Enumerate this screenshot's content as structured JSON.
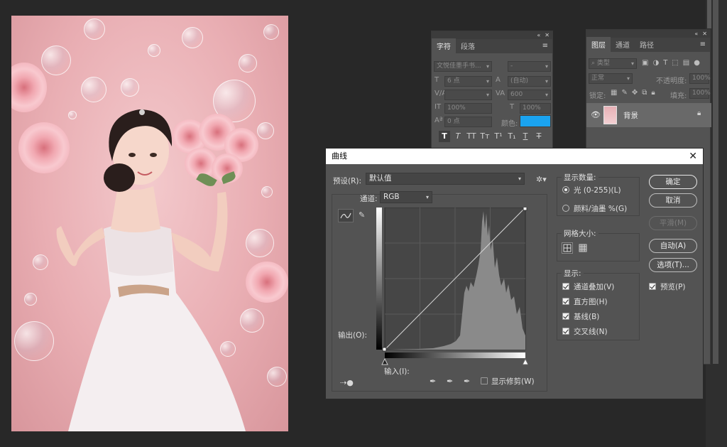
{
  "character_panel": {
    "tabs": [
      "字符",
      "段落"
    ],
    "font_family": "文悦佳墨手书...",
    "font_style": "-",
    "font_size": "6 点",
    "leading": "(自动)",
    "kerning": "",
    "tracking": "600",
    "vertical_scale": "100%",
    "horizontal_scale": "100%",
    "baseline_shift": "0 点",
    "color_label": "颜色:",
    "color_value": "#1aa3f0",
    "style_buttons": [
      "T",
      "T",
      "TT",
      "Tт",
      "T¹",
      "T₁",
      "T",
      "T"
    ]
  },
  "layers_panel": {
    "tabs": [
      "图层",
      "通道",
      "路径"
    ],
    "filter_placeholder": "类型",
    "blend_mode": "正常",
    "opacity_label": "不透明度:",
    "opacity_value": "100%",
    "lock_label": "锁定:",
    "fill_label": "填充:",
    "fill_value": "100%",
    "layer_name": "背景"
  },
  "curves_dialog": {
    "title": "曲线",
    "preset_label": "预设(R):",
    "preset_value": "默认值",
    "channel_label": "通道:",
    "channel_value": "RGB",
    "output_label": "输出(O):",
    "input_label": "输入(I):",
    "show_clipping": "显示修剪(W)",
    "show_amount_title": "显示数量:",
    "light_option": "光 (0-255)(L)",
    "pigment_option": "颜料/油墨 %(G)",
    "grid_size_title": "网格大小:",
    "show_title": "显示:",
    "show_options": [
      "通道叠加(V)",
      "直方图(H)",
      "基线(B)",
      "交叉线(N)"
    ],
    "buttons": {
      "ok": "确定",
      "cancel": "取消",
      "smooth": "平滑(M)",
      "auto": "自动(A)",
      "options": "选项(T)..."
    },
    "preview_label": "预览(P)",
    "accent": "#ffffff"
  }
}
